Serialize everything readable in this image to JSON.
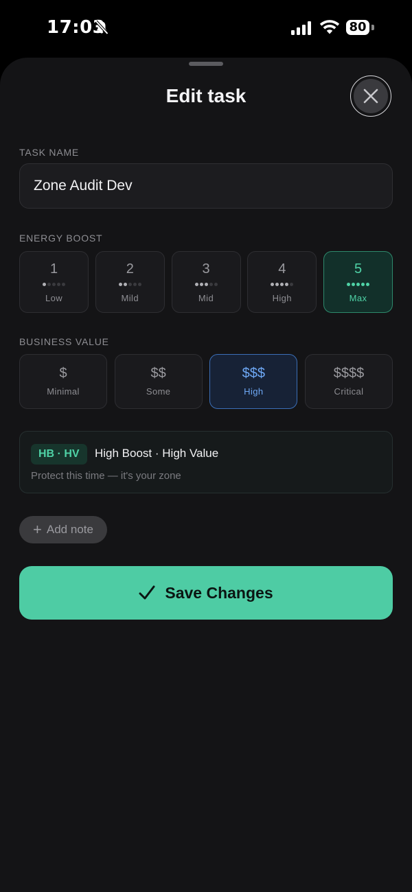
{
  "status_bar": {
    "time": "17:03",
    "battery": "80"
  },
  "sheet": {
    "title": "Edit task"
  },
  "task_name": {
    "label": "TASK NAME",
    "value": "Zone Audit Dev"
  },
  "energy_boost": {
    "label": "ENERGY BOOST",
    "selected": 5,
    "options": [
      {
        "number": "1",
        "label": "Low",
        "level": 1
      },
      {
        "number": "2",
        "label": "Mild",
        "level": 2
      },
      {
        "number": "3",
        "label": "Mid",
        "level": 3
      },
      {
        "number": "4",
        "label": "High",
        "level": 4
      },
      {
        "number": "5",
        "label": "Max",
        "level": 5
      }
    ]
  },
  "business_value": {
    "label": "BUSINESS VALUE",
    "selected": 3,
    "options": [
      {
        "symbol": "$",
        "label": "Minimal"
      },
      {
        "symbol": "$$",
        "label": "Some"
      },
      {
        "symbol": "$$$",
        "label": "High"
      },
      {
        "symbol": "$$$$",
        "label": "Critical"
      }
    ]
  },
  "zone": {
    "badge": "HB · HV",
    "title": "High Boost · High Value",
    "subtitle": "Protect this time — it's your zone"
  },
  "add_note": {
    "label": "Add note"
  },
  "save": {
    "label": "Save Changes"
  },
  "colors": {
    "accent_green": "#4ecca4",
    "accent_blue": "#6ea8f5",
    "sheet_bg": "#141416"
  },
  "icons": [
    "bell-slash-icon",
    "signal-icon",
    "wifi-icon",
    "close-icon",
    "plus-icon",
    "checkmark-icon"
  ]
}
